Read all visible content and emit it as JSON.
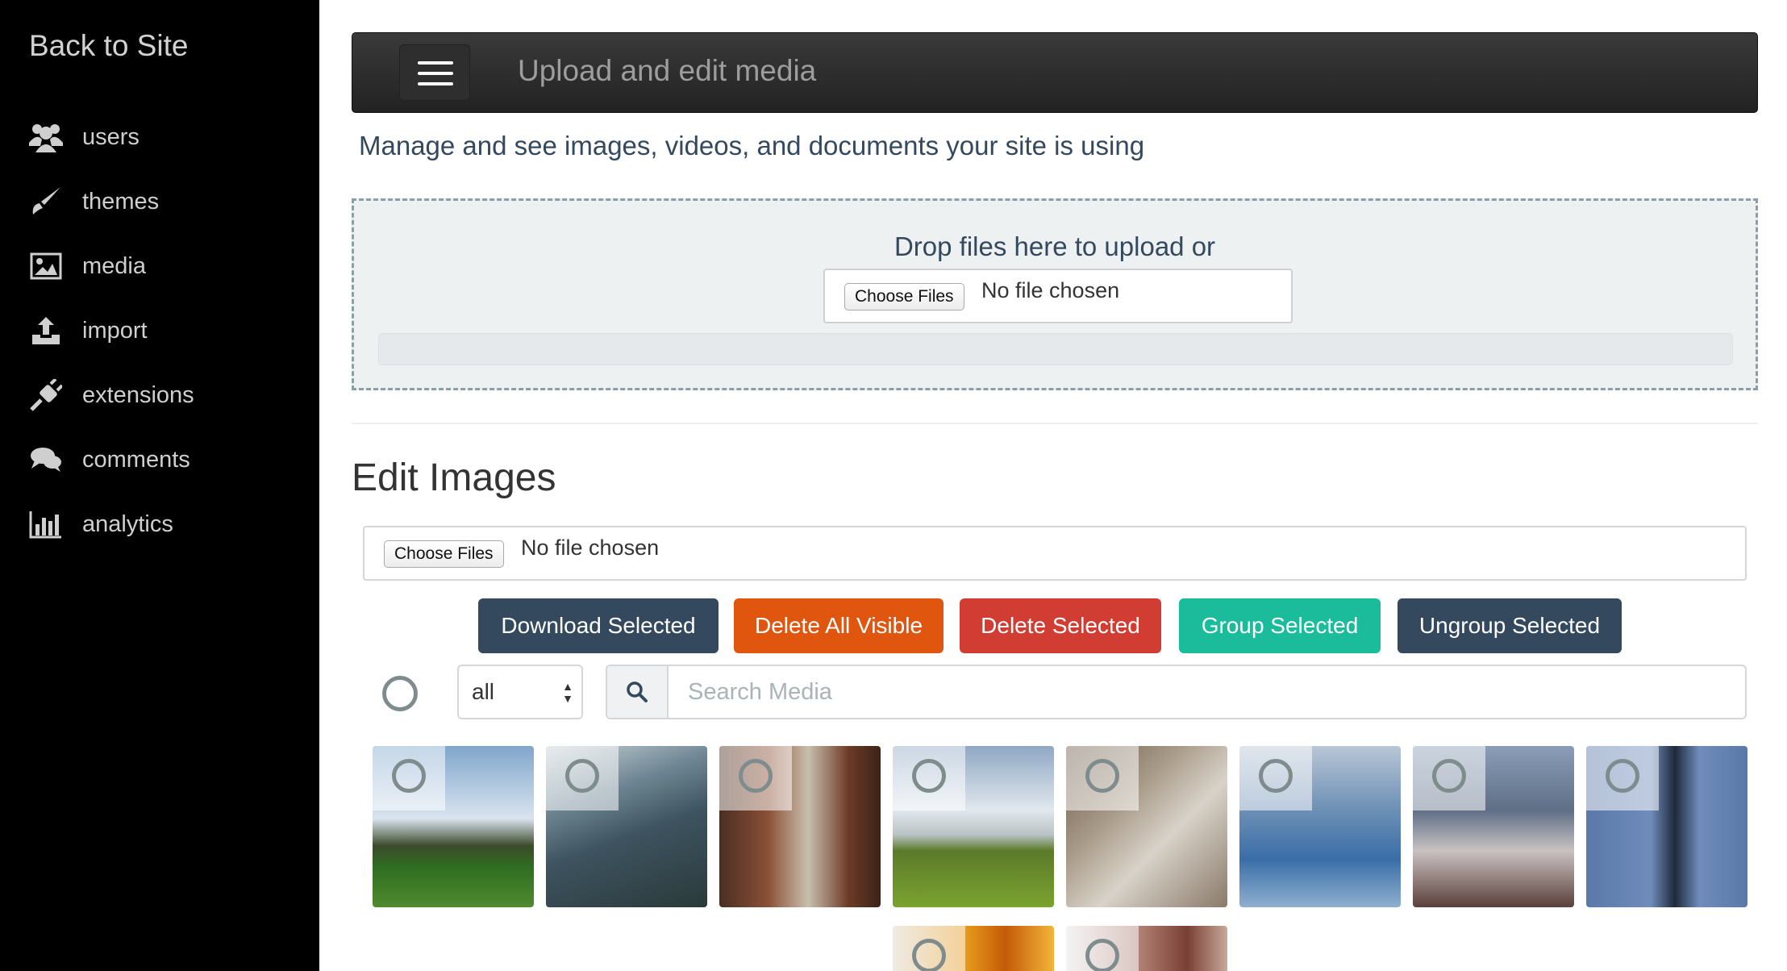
{
  "sidebar": {
    "back_label": "Back to Site",
    "items": [
      {
        "label": "users",
        "icon": "users-icon"
      },
      {
        "label": "themes",
        "icon": "brush-icon"
      },
      {
        "label": "media",
        "icon": "image-icon"
      },
      {
        "label": "import",
        "icon": "upload-icon"
      },
      {
        "label": "extensions",
        "icon": "plug-icon"
      },
      {
        "label": "comments",
        "icon": "comments-icon"
      },
      {
        "label": "analytics",
        "icon": "bar-chart-icon"
      }
    ]
  },
  "header": {
    "title": "Upload and edit media",
    "subtitle": "Manage and see images, videos, and documents your site is using"
  },
  "dropzone": {
    "text": "Drop files here to upload or",
    "choose_label": "Choose Files",
    "no_file_text": "No file chosen"
  },
  "edit": {
    "title": "Edit Images",
    "choose_label": "Choose Files",
    "no_file_text": "No file chosen"
  },
  "actions": {
    "download": "Download Selected",
    "delete_visible": "Delete All Visible",
    "delete_selected": "Delete Selected",
    "group": "Group Selected",
    "ungroup": "Ungroup Selected"
  },
  "filter": {
    "selected": "all",
    "search_placeholder": "Search Media"
  },
  "colors": {
    "sidebar_bg": "#000000",
    "primary": "#34495e",
    "orange": "#e0560f",
    "red": "#d23d33",
    "teal": "#1abc9c"
  },
  "thumbnails": [
    {
      "name": "farm-field-image"
    },
    {
      "name": "lake-branches-image"
    },
    {
      "name": "rusty-meter-image"
    },
    {
      "name": "farmhouse-field-image"
    },
    {
      "name": "classroom-image"
    },
    {
      "name": "water-reflection-image"
    },
    {
      "name": "mountain-flowers-image"
    },
    {
      "name": "streetlight-image"
    },
    {
      "name": "fire-image"
    },
    {
      "name": "autumn-tree-image"
    }
  ]
}
